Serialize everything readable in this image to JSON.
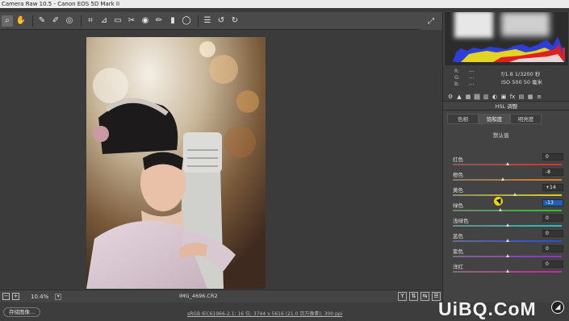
{
  "window": {
    "title": "Camera Raw 10.5 -  Canon EOS 5D Mark II"
  },
  "toolbar": {
    "tools": [
      {
        "name": "zoom-tool-icon",
        "glyph": "⌕"
      },
      {
        "name": "hand-tool-icon",
        "glyph": "✋"
      },
      {
        "name": "white-balance-tool-icon",
        "glyph": "✎"
      },
      {
        "name": "color-sampler-tool-icon",
        "glyph": "✐"
      },
      {
        "name": "targeted-adjustment-tool-icon",
        "glyph": "◎"
      },
      {
        "name": "crop-tool-icon",
        "glyph": "⌗"
      },
      {
        "name": "straighten-tool-icon",
        "glyph": "⊿"
      },
      {
        "name": "transform-tool-icon",
        "glyph": "▭"
      },
      {
        "name": "spot-removal-tool-icon",
        "glyph": "✂"
      },
      {
        "name": "red-eye-tool-icon",
        "glyph": "◉"
      },
      {
        "name": "adjustment-brush-icon",
        "glyph": "✏"
      },
      {
        "name": "graduated-filter-icon",
        "glyph": "▮"
      },
      {
        "name": "radial-filter-icon",
        "glyph": "◯"
      },
      {
        "name": "preferences-icon",
        "glyph": "☰"
      },
      {
        "name": "rotate-left-icon",
        "glyph": "↺"
      },
      {
        "name": "rotate-right-icon",
        "glyph": "↻"
      }
    ],
    "fullscreen_glyph": "⤢"
  },
  "histogram": {
    "rgb_labels": [
      "R:",
      "G:",
      "B:"
    ],
    "rgb_values": [
      "---",
      "---",
      "---"
    ],
    "aperture_shutter": "f/1.8    1/3200 秒",
    "iso_focal": "ISO 500    50 毫米"
  },
  "panel": {
    "icons": [
      "⚙",
      "▲",
      "▦",
      "▤",
      "▥",
      "◐",
      "▣",
      "fx",
      "▤",
      "▦",
      "≡"
    ],
    "title": "HSL 调整",
    "tabs": [
      "色相",
      "饱和度",
      "明亮度"
    ],
    "active_tab": 1,
    "default_link": "默认值",
    "sliders": [
      {
        "label": "红色",
        "value": "0",
        "pos": 0.5,
        "color": "linear-gradient(90deg,#8a5a5a,#d33)"
      },
      {
        "label": "橙色",
        "value": "-8",
        "pos": 0.46,
        "color": "linear-gradient(90deg,#8a7a6a,#e07a20)"
      },
      {
        "label": "黄色",
        "value": "+14",
        "pos": 0.57,
        "color": "linear-gradient(90deg,#8a8a6a,#e0d020)"
      },
      {
        "label": "绿色",
        "value": "-13",
        "pos": 0.44,
        "color": "linear-gradient(90deg,#6a8a6a,#2ec02e)",
        "highlight": true
      },
      {
        "label": "浅绿色",
        "value": "0",
        "pos": 0.5,
        "color": "linear-gradient(90deg,#6a8a8a,#20c0c0)"
      },
      {
        "label": "蓝色",
        "value": "0",
        "pos": 0.5,
        "color": "linear-gradient(90deg,#6a6a8a,#2050e0)"
      },
      {
        "label": "紫色",
        "value": "0",
        "pos": 0.5,
        "color": "linear-gradient(90deg,#7a6a8a,#9030d0)"
      },
      {
        "label": "洋红",
        "value": "0",
        "pos": 0.5,
        "color": "linear-gradient(90deg,#8a6a7a,#d020a0)"
      }
    ]
  },
  "statusbar": {
    "zoom": "10.4%",
    "filename": "IMG_4696.CR2",
    "icons": [
      "Y",
      "⇅",
      "⇆",
      "☰"
    ]
  },
  "footer": {
    "save_label": "存储图像...",
    "workflow_link": "sRGB IEC61966-2.1; 16 位; 3744 x 5616 (21.0 百万像素); 300 ppi"
  },
  "watermark": {
    "text": "UiBQ.CoM"
  }
}
